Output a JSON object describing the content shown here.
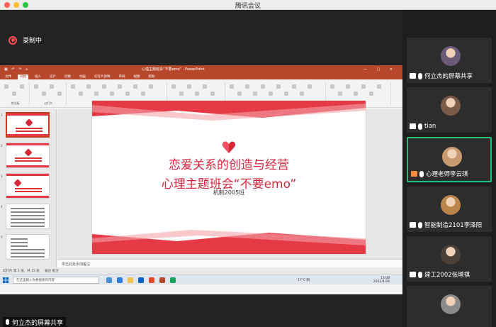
{
  "window": {
    "title": "腾讯会议"
  },
  "recording": {
    "label": "录制中"
  },
  "ppt": {
    "titlebar_text": "心理主题班会“不要emo”",
    "app_name": "PowerPoint",
    "tabs": [
      "文件",
      "开始",
      "插入",
      "设计",
      "切换",
      "动画",
      "幻灯片放映",
      "审阅",
      "视图",
      "帮助"
    ],
    "ribbon_groups": [
      "剪贴板",
      "幻灯片",
      "字体",
      "段落",
      "绘图",
      "编辑"
    ],
    "notes_placeholder": "单击此处添加备注",
    "status_text": "幻灯片 第 1 张，共 15 张",
    "status_right": "备注  批注",
    "taskbar_search": "在这里输入你要搜索的内容",
    "weather": "17°C 阴",
    "time": "13:08",
    "date": "2022/4/28"
  },
  "slide": {
    "title_line1": "恋爱关系的创造与经营",
    "title_line2": "心理主题班会“不要emo”",
    "class_name": "机制2005班"
  },
  "share": {
    "label": "何立杰的屏幕共享"
  },
  "participants": [
    {
      "name": "何立杰的屏幕共享",
      "avatar_color": "#6a5a78",
      "badge": "share-icon",
      "active": false
    },
    {
      "name": "tian",
      "avatar_color": "#7a5a48",
      "badge": "user-icon",
      "active": false
    },
    {
      "name": "心理老师李云琪",
      "avatar_color": "#c89a70",
      "badge": "user-icon",
      "active": true
    },
    {
      "name": "智能制造2101李泽阳",
      "avatar_color": "#b9854a",
      "badge": "user-icon",
      "active": false
    },
    {
      "name": "建工2002张增祺",
      "avatar_color": "#4a4038",
      "badge": "user-icon",
      "active": false
    },
    {
      "name": "",
      "avatar_color": "#8a8a8a",
      "badge": "",
      "active": false
    }
  ],
  "colors": {
    "accent": "#1ec07a",
    "ppt_red": "#b7472a",
    "slide_red": "#d7263d",
    "recording": "#ff4d4f"
  }
}
